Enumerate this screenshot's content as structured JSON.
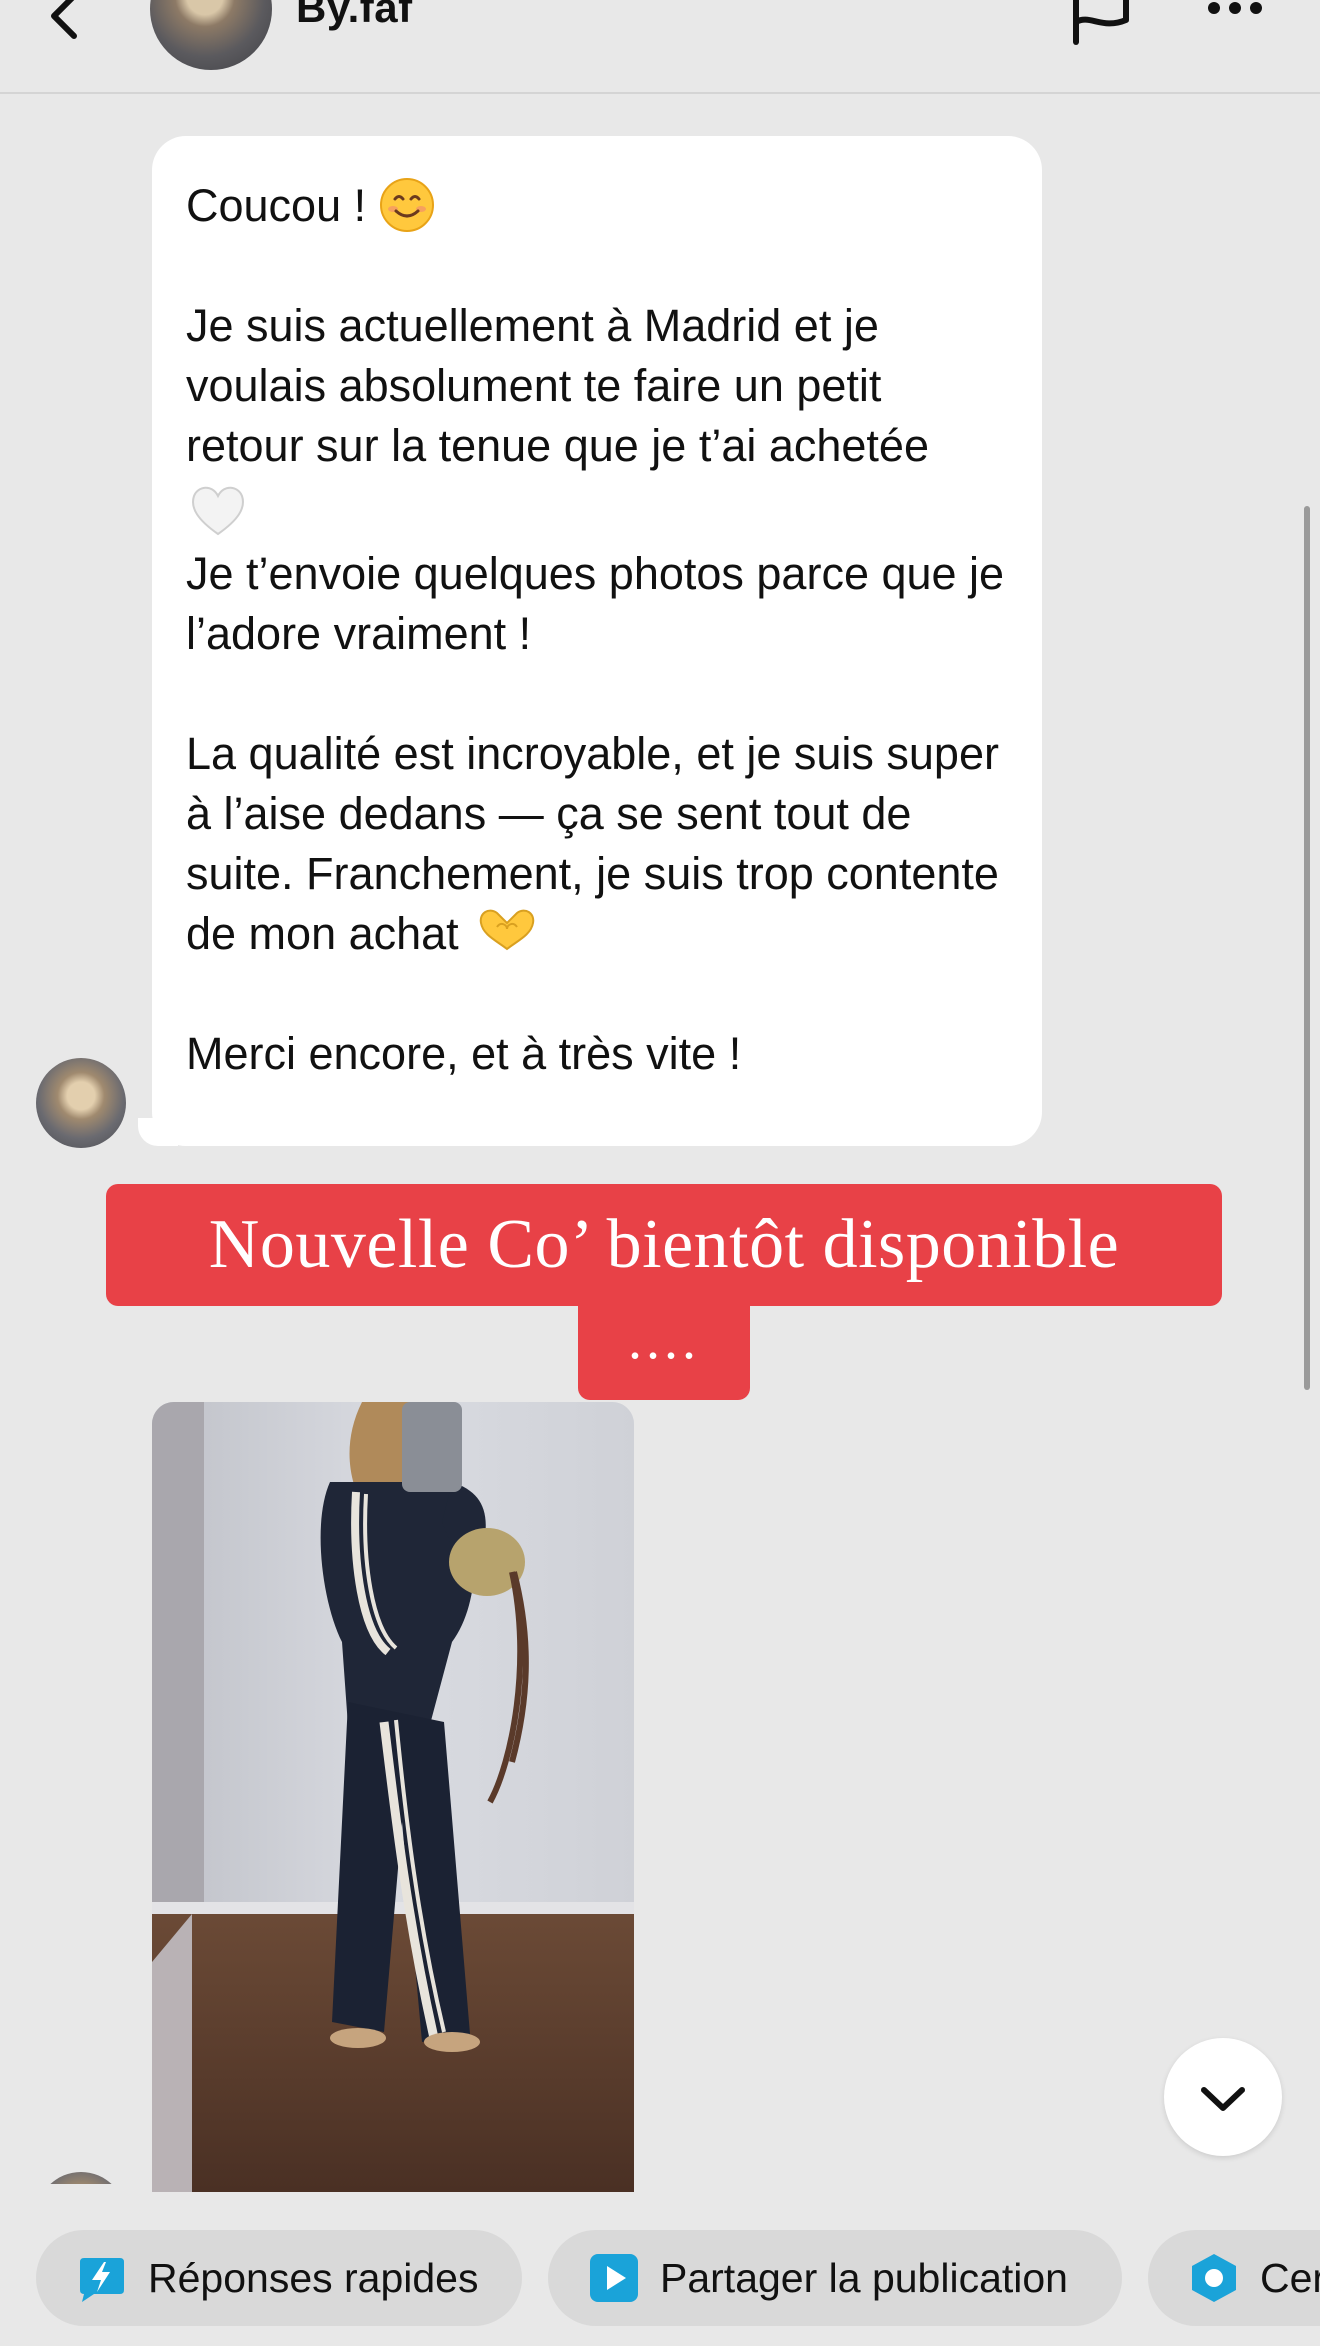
{
  "header": {
    "name": "By.faf"
  },
  "message": {
    "line1": "Coucou !",
    "para2": "Je suis actuellement à Madrid et je voulais absolument te faire un petit retour sur la tenue que je t’ai achetée",
    "para3": "Je t’envoie quelques photos parce que je l’adore vraiment !",
    "para4": "La qualité est incroyable, et je suis super à l’aise dedans — ça se sent tout de suite. Franchement, je suis trop contente de mon achat",
    "para5": "Merci encore, et à très vite !"
  },
  "promo": {
    "headline": "Nouvelle Co’ bientôt disponible",
    "dots": "...."
  },
  "quick_actions": [
    {
      "label": "Réponses rapides",
      "icon": "lightning-icon"
    },
    {
      "label": "Partager la publication",
      "icon": "play-icon"
    },
    {
      "label": "Cer",
      "icon": "hexagon-icon"
    }
  ],
  "colors": {
    "promo_red": "#e84147",
    "chip_bg": "#d9d9d9",
    "icon_blue": "#1aa3d9",
    "background": "#e8e8e8"
  }
}
